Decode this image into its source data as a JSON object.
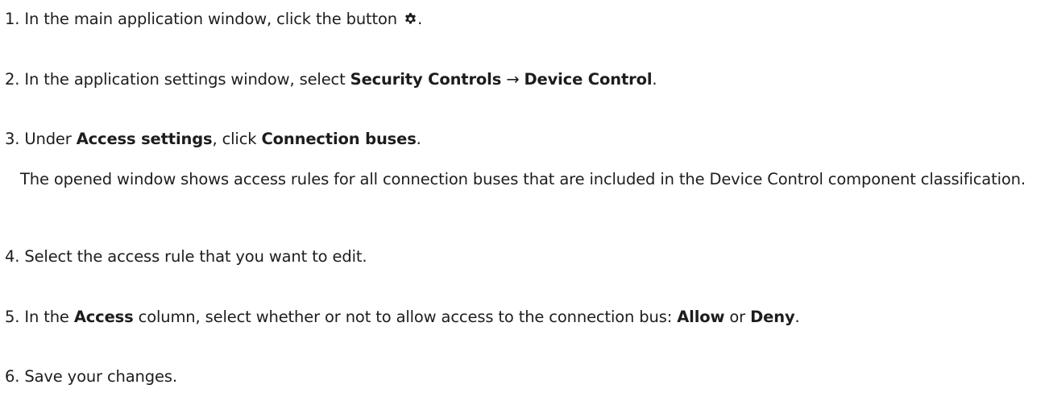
{
  "steps": [
    {
      "n": "1.",
      "t1": " In the main application window, click the button ",
      "t2": "."
    },
    {
      "n": "2.",
      "t1": " In the application settings window, select ",
      "b1": "Security Controls",
      "arrow": " → ",
      "b2": "Device Control",
      "t2": "."
    },
    {
      "n": "3.",
      "t1": " Under ",
      "b1": "Access settings",
      "t2": ", click ",
      "b2": "Connection buses",
      "t3": ".",
      "note": "The opened window shows access rules for all connection buses that are included in the Device Control component classification."
    },
    {
      "n": "4.",
      "t1": " Select the access rule that you want to edit."
    },
    {
      "n": "5.",
      "t1": " In the ",
      "b1": "Access",
      "t2": " column, select whether or not to allow access to the connection bus: ",
      "b2": "Allow",
      "t3": " or ",
      "b3": "Deny",
      "t4": "."
    },
    {
      "n": "6.",
      "t1": " Save your changes."
    }
  ],
  "icons": {
    "settings": "gear-icon"
  }
}
